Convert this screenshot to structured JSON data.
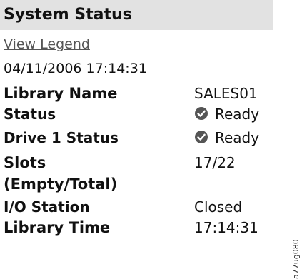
{
  "panel": {
    "title": "System Status",
    "legend_link": "View Legend",
    "timestamp": "04/11/2006 17:14:31"
  },
  "rows": [
    {
      "label": "Library Name",
      "value": "SALES01"
    },
    {
      "label": "Status",
      "value": "Ready",
      "icon": "check-circle-icon"
    },
    {
      "label": "Drive 1 Status",
      "value": "Ready",
      "icon": "check-circle-icon"
    },
    {
      "label": "Slots",
      "label2": "(Empty/Total)",
      "value": "17/22"
    },
    {
      "label": "I/O Station",
      "value": "Closed"
    },
    {
      "label": "Library Time",
      "value": "17:14:31"
    }
  ],
  "figure_code": "a77ug080",
  "colors": {
    "header_bg": "#e2e2e2",
    "link": "#555555",
    "icon": "#555555"
  }
}
